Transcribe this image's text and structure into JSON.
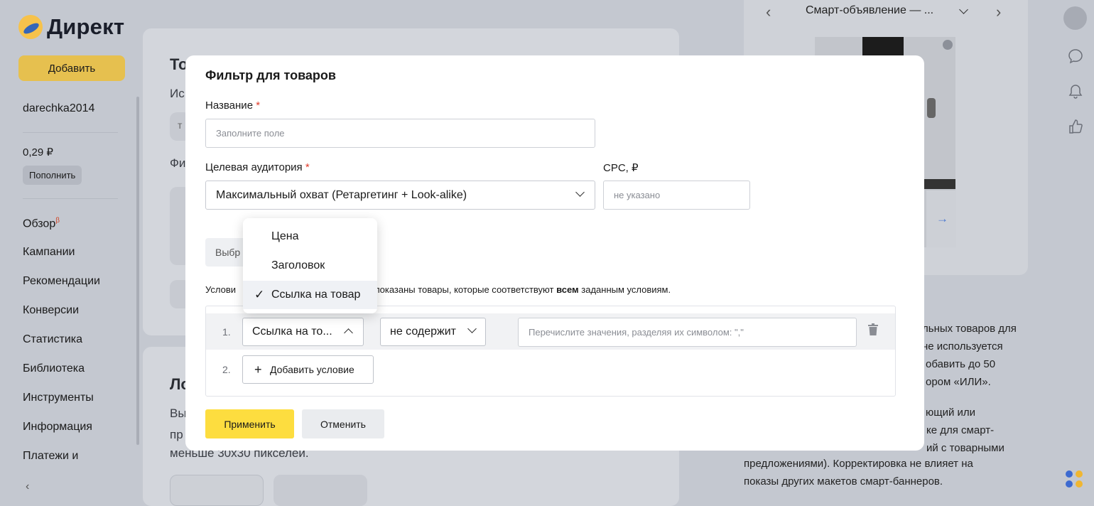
{
  "sidebar": {
    "logo": "Директ",
    "add_button": "Добавить",
    "username": "darechka2014",
    "balance": "0,29 ₽",
    "topup": "Пополнить",
    "nav": [
      {
        "label": "Обзор",
        "badge": "β"
      },
      {
        "label": "Кампании"
      },
      {
        "label": "Рекомендации"
      },
      {
        "label": "Конверсии"
      },
      {
        "label": "Статистика"
      },
      {
        "label": "Библиотека"
      },
      {
        "label": "Инструменты"
      },
      {
        "label": "Информация"
      },
      {
        "label": "Платежи и"
      }
    ],
    "collapse_icon": "chevron-left-icon"
  },
  "background": {
    "card1_title": "То",
    "card1_sub": "Ис",
    "card1_input": "т",
    "card1_fi": "Фи",
    "card2_title": "Ло",
    "card2_line1": "Вы",
    "card2_line2": "пр",
    "card2_line3": "меньше 30x30 пикселей.",
    "preview_title": "Смарт-объявление — ...",
    "right_text": [
      "льных товаров для",
      "не используется",
      "обавить до 50",
      "ором «ИЛИ».",
      "ющий или",
      "ке для смарт-",
      "ий с товарными",
      "предложениями). Корректировка не влияет на",
      "показы других макетов смарт-баннеров."
    ]
  },
  "modal": {
    "title": "Фильтр для товаров",
    "name_label": "Название",
    "name_placeholder": "Заполните поле",
    "audience_label": "Целевая аудитория",
    "audience_value": "Максимальный охват (Ретаргетинг + Look-alike)",
    "cpc_label": "CPC, ₽",
    "cpc_placeholder": "не указано",
    "select_btn": "Выбр",
    "conditions_prefix": "Услови",
    "conditions_mid": "т показаны товары, которые соответствуют ",
    "conditions_bold": "всем",
    "conditions_suffix": " заданным условиям.",
    "dropdown_items": [
      "Цена",
      "Заголовок",
      "Ссылка на товар"
    ],
    "dropdown_selected_mark": "✓",
    "row1_num": "1.",
    "row1_field": "Ссылка на то...",
    "row1_op": "не содержит",
    "row1_placeholder": "Перечислите значения, разделяя их символом: \",\"",
    "row2_num": "2.",
    "add_condition": "Добавить условие",
    "apply": "Применить",
    "cancel": "Отменить"
  }
}
